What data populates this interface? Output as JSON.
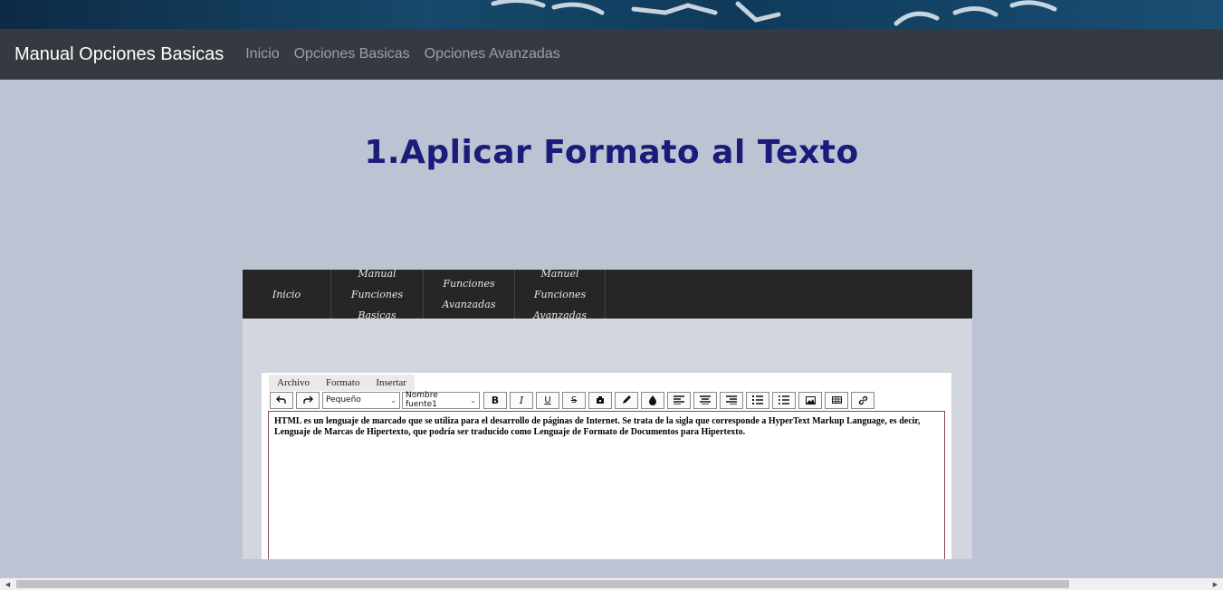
{
  "navbar": {
    "brand": "Manual Opciones Basicas",
    "links": [
      "Inicio",
      "Opciones Basicas",
      "Opciones Avanzadas"
    ]
  },
  "main": {
    "title": "1.Aplicar Formato al Texto"
  },
  "screenshot": {
    "nav": {
      "inicio": "Inicio",
      "manual_l1": "Manual Funciones",
      "manual_l2": "Basicas",
      "avanzadas": "Funciones Avanzadas",
      "manual_av_l1": "Manuel Funciones",
      "manual_av_l2": "Avanzadas"
    },
    "menubar": [
      "Archivo",
      "Formato",
      "Insertar"
    ],
    "toolbar": {
      "size_select": "Pequeño",
      "font_select": "Nombre fuente1",
      "bold": "B",
      "italic": "I",
      "underline": "U",
      "strike": "S"
    },
    "content": "HTML es un lenguaje de marcado que se utiliza para el desarrollo de páginas de Internet. Se trata de la sigla que corresponde a HyperText Markup Language, es decir, Lenguaje de Marcas de Hipertexto, que podría ser traducido como Lenguaje de Formato de Documentos para Hipertexto."
  },
  "icons": [
    "undo-icon",
    "redo-icon",
    "eraser-icon",
    "pencil-icon",
    "ink-drop-icon",
    "align-left-icon",
    "align-center-icon",
    "align-right-icon",
    "bullet-list-icon",
    "numbered-list-icon",
    "image-icon",
    "table-icon",
    "link-icon"
  ],
  "colors": {
    "page_bg": "#bcc3d3",
    "navbar_bg": "#343a40",
    "title": "#1b1b7a",
    "inner_nav_bg": "#262626"
  }
}
